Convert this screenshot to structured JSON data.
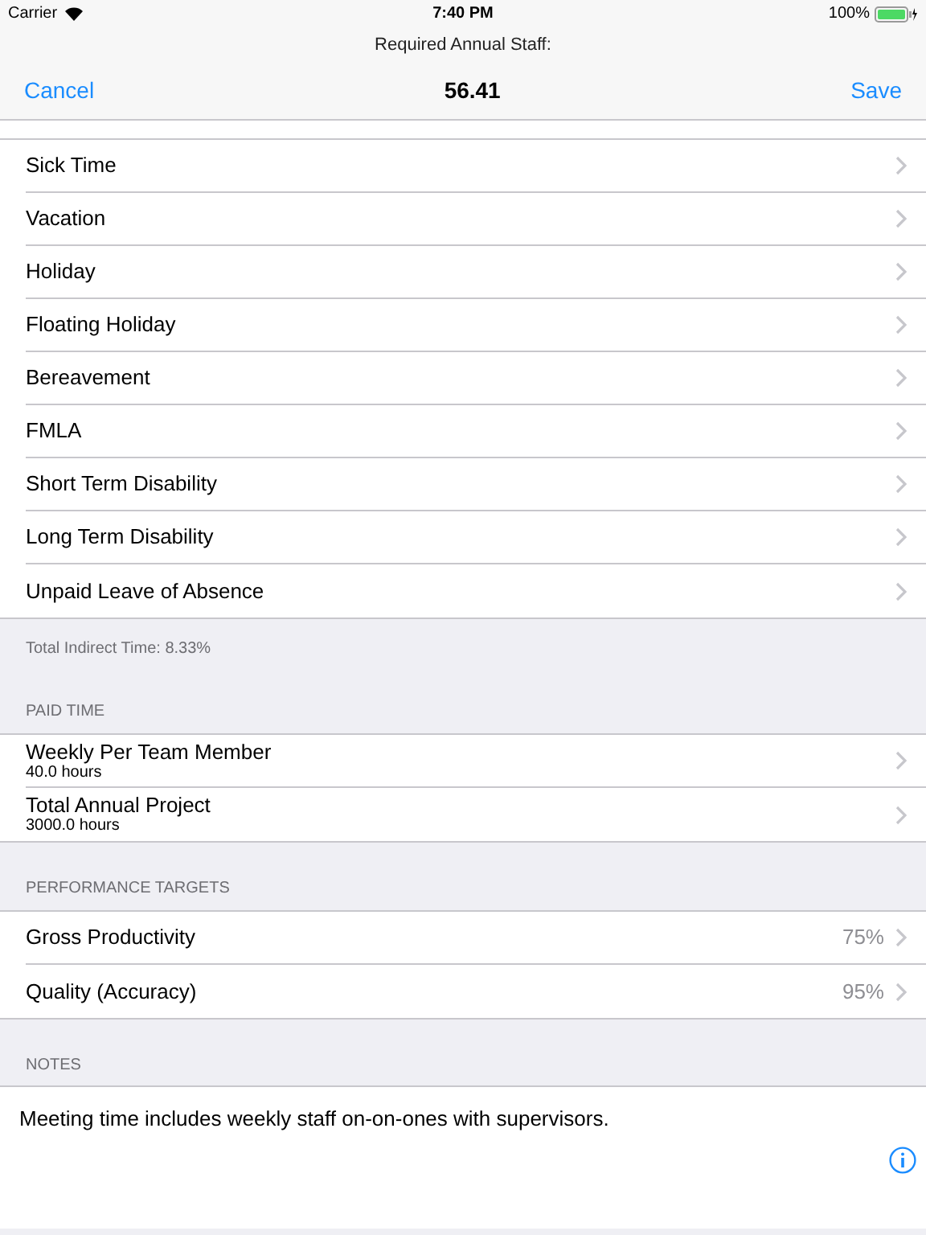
{
  "status_bar": {
    "carrier": "Carrier",
    "time": "7:40 PM",
    "battery": "100%"
  },
  "nav": {
    "prompt": "Required Annual Staff:",
    "title": "56.41",
    "left_button": "Cancel",
    "right_button": "Save"
  },
  "sections": [
    {
      "footer": "Total Indirect Time: 8.33%",
      "rows": [
        {
          "label": "Sick Time"
        },
        {
          "label": "Vacation"
        },
        {
          "label": "Holiday"
        },
        {
          "label": "Floating Holiday"
        },
        {
          "label": "Bereavement"
        },
        {
          "label": "FMLA"
        },
        {
          "label": "Short Term Disability"
        },
        {
          "label": "Long Term Disability"
        },
        {
          "label": "Unpaid Leave of Absence"
        }
      ]
    },
    {
      "header": "PAID TIME",
      "rows": [
        {
          "label": "Weekly Per Team Member",
          "subtitle": "40.0 hours"
        },
        {
          "label": "Total Annual Project",
          "subtitle": "3000.0 hours"
        }
      ]
    },
    {
      "header": "PERFORMANCE TARGETS",
      "rows": [
        {
          "label": "Gross Productivity",
          "value": "75%"
        },
        {
          "label": "Quality (Accuracy)",
          "value": "95%"
        }
      ]
    }
  ],
  "notes": {
    "header": "NOTES",
    "text": "Meeting time includes weekly staff on-on-ones with supervisors."
  }
}
